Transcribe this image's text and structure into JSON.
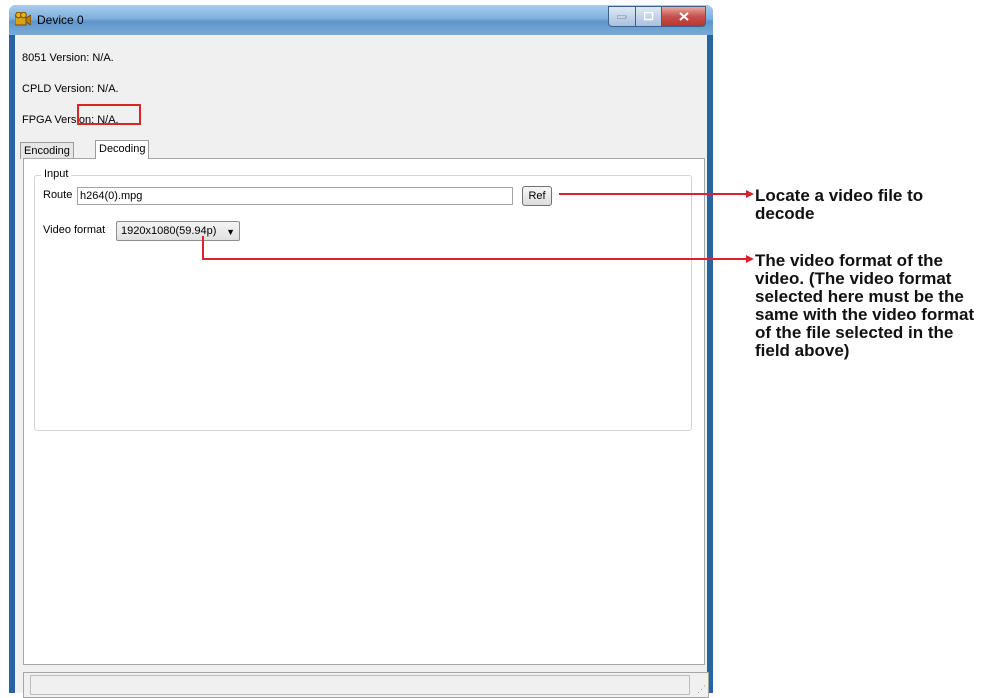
{
  "window": {
    "title": "Device 0",
    "versions": [
      "8051 Version: N/A.",
      "CPLD Version: N/A.",
      "FPGA Version: N/A."
    ],
    "tabs": [
      {
        "label": "Encoding",
        "active": false
      },
      {
        "label": "Decoding",
        "active": true
      }
    ]
  },
  "decoding": {
    "group_title": "Input",
    "route_label": "Route",
    "route_value": "h264(0).mpg",
    "ref_button": "Ref",
    "video_format_label": "Video format",
    "video_format_value": "1920x1080(59.94p)"
  },
  "callouts": {
    "ref": "Locate a video file to decode",
    "format": "The video format of the video. (The video format selected here must be the same with the video format of the file selected in the field above)"
  },
  "colors": {
    "highlight": "#d7252b",
    "title_bar": "#7fb0dc",
    "close_button": "#c75050"
  }
}
